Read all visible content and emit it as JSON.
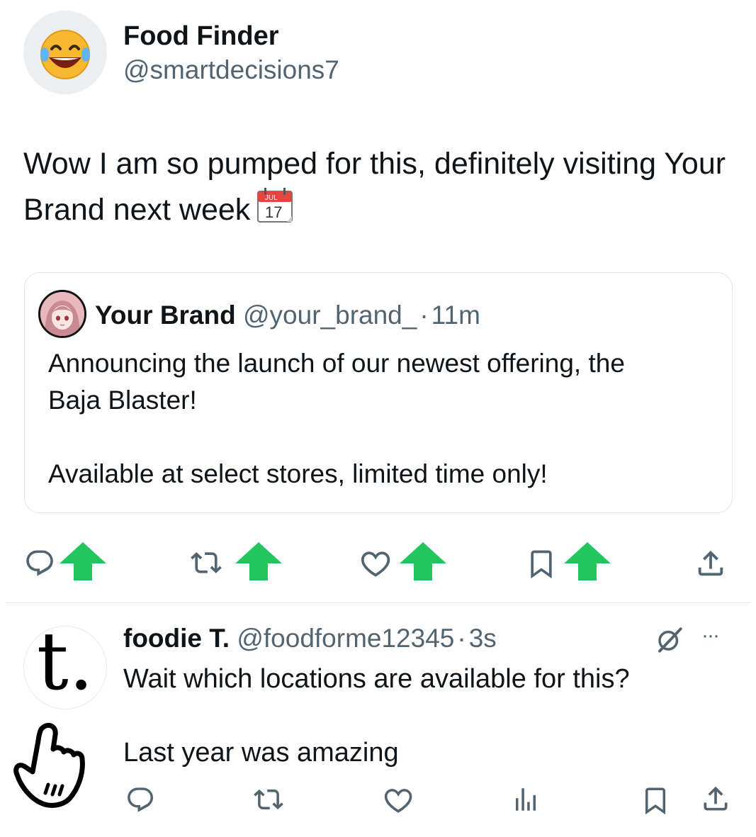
{
  "post": {
    "author_name": "Food Finder",
    "author_handle": "@smartdecisions7",
    "avatar_icon": "laughing-face-emoji",
    "text": "Wow I am so pumped for this, definitely visiting Your Brand next week",
    "emoji_icon": "calendar-emoji",
    "emoji_month": "JUL",
    "emoji_day": "17"
  },
  "quote": {
    "author_name": "Your Brand",
    "author_handle": "@your_brand_",
    "separator": "·",
    "time": "11m",
    "text": "Announcing the launch of our newest offering, the\nBaja Blaster!\n\nAvailable at select stores, limited time only!"
  },
  "actions": {
    "items": [
      "reply",
      "repost",
      "like",
      "bookmark",
      "share"
    ],
    "arrow_color": "#22c55e",
    "icon_color": "#536471"
  },
  "reply": {
    "author_name": "foodie T.",
    "author_handle": "@foodforme12345",
    "separator": "·",
    "time": "3s",
    "avatar_letter": "t.",
    "line1": "Wait which locations are available for this?",
    "line2": "Last year was amazing",
    "more_icon": "···"
  },
  "colors": {
    "text": "#0f1419",
    "muted": "#536471",
    "border": "#e1e6ea",
    "accent_green": "#22c55e"
  }
}
